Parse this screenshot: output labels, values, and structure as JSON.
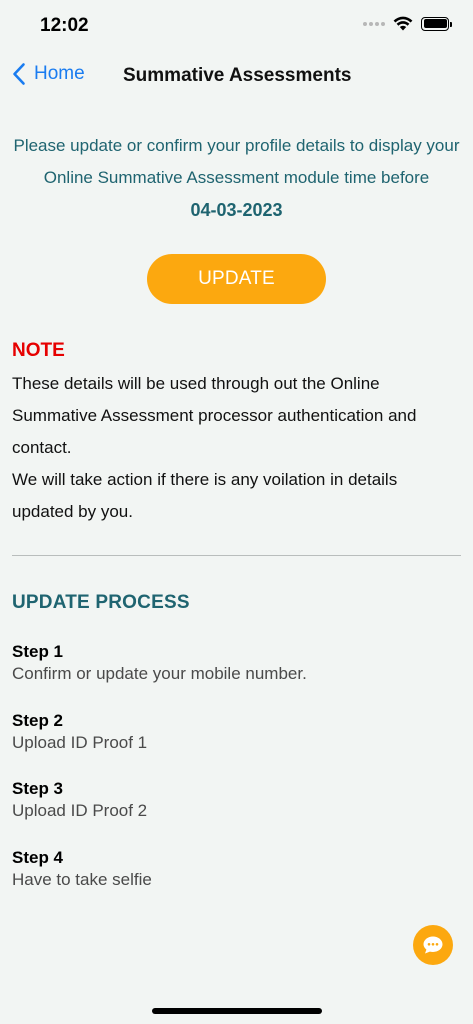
{
  "status_bar": {
    "time": "12:02",
    "icons": [
      "signal-dots-icon",
      "wifi-icon",
      "battery-icon"
    ]
  },
  "nav": {
    "back_label": "Home",
    "title": "Summative Assessments"
  },
  "intro": {
    "message": "Please update or confirm your profile details to display your Online Summative Assessment module time before",
    "date": "04-03-2023"
  },
  "update_button": {
    "label": "UPDATE"
  },
  "note": {
    "heading": "NOTE",
    "line1": "These details will be used through out the Online Summative Assessment processor authentication and contact.",
    "line2": "We will take action if there is any voilation in details updated by you."
  },
  "process": {
    "heading": "UPDATE PROCESS",
    "steps": [
      {
        "title": "Step 1",
        "desc": "Confirm or update your mobile number."
      },
      {
        "title": "Step 2",
        "desc": "Upload ID Proof 1"
      },
      {
        "title": "Step 3",
        "desc": "Upload ID Proof 2"
      },
      {
        "title": "Step 4",
        "desc": "Have to take selfie"
      }
    ]
  },
  "chat_button": {
    "icon": "chat-bubble-icon"
  },
  "colors": {
    "background": "#f2f5f3",
    "accent": "#fca80f",
    "teal": "#1f6470",
    "link": "#1a7cf0",
    "note_red": "#e60000"
  }
}
